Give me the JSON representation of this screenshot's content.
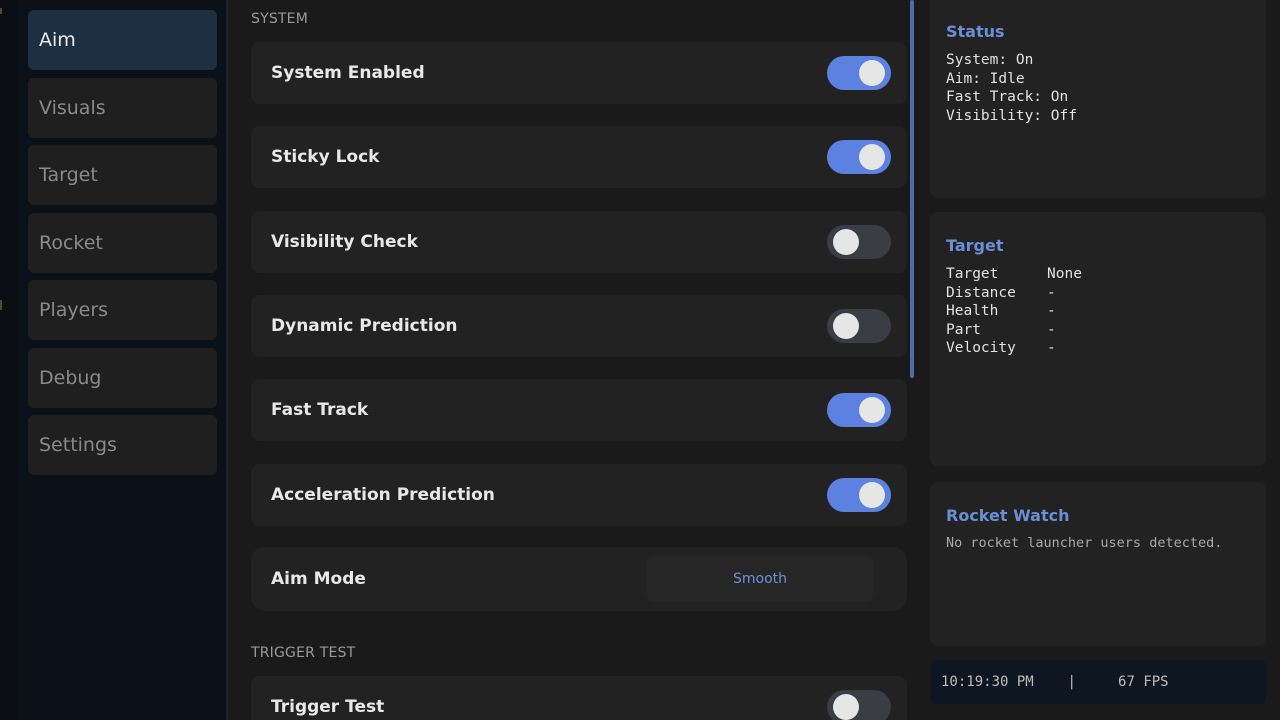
{
  "sidebar": {
    "items": [
      {
        "label": "Aim",
        "active": true
      },
      {
        "label": "Visuals",
        "active": false
      },
      {
        "label": "Target",
        "active": false
      },
      {
        "label": "Rocket",
        "active": false
      },
      {
        "label": "Players",
        "active": false
      },
      {
        "label": "Debug",
        "active": false
      },
      {
        "label": "Settings",
        "active": false
      }
    ]
  },
  "main": {
    "system_header": "SYSTEM",
    "toggles": [
      {
        "label": "System Enabled",
        "on": true
      },
      {
        "label": "Sticky Lock",
        "on": true
      },
      {
        "label": "Visibility Check",
        "on": false
      },
      {
        "label": "Dynamic Prediction",
        "on": false
      },
      {
        "label": "Fast Track",
        "on": true
      },
      {
        "label": "Acceleration Prediction",
        "on": true
      }
    ],
    "aim_mode": {
      "label": "Aim Mode",
      "value": "Smooth"
    },
    "trigger_header": "TRIGGER TEST",
    "trigger": {
      "label": "Trigger Test",
      "on": false
    }
  },
  "status": {
    "title": "Status",
    "lines": [
      "System: On",
      "Aim: Idle",
      "Fast Track: On",
      "Visibility: Off"
    ]
  },
  "target": {
    "title": "Target",
    "rows": [
      {
        "key": "Target",
        "value": "None"
      },
      {
        "key": "Distance",
        "value": "-"
      },
      {
        "key": "Health",
        "value": "-"
      },
      {
        "key": "Part",
        "value": "-"
      },
      {
        "key": "Velocity",
        "value": "-"
      }
    ]
  },
  "rocket_watch": {
    "title": "Rocket Watch",
    "message": "No rocket launcher users detected."
  },
  "footer": {
    "time": "10:19:30 PM",
    "separator": "|",
    "fps": "67 FPS"
  },
  "colors": {
    "accent": "#5b82e0",
    "title_blue": "#6a8fd6",
    "active_nav": "#1d2f40"
  }
}
